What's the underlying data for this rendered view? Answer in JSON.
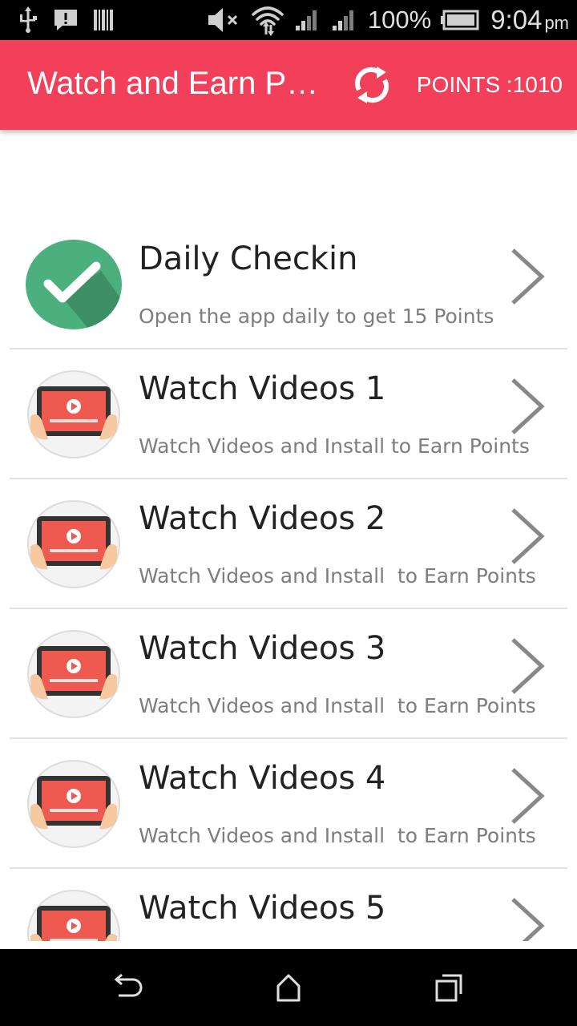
{
  "status_bar": {
    "battery": "100%",
    "time": "9:04",
    "ampm": "pm"
  },
  "app_bar": {
    "title": "Watch and Earn Pa...",
    "points_label": "POINTS :1010",
    "accent": "#f2405a"
  },
  "list": {
    "items": [
      {
        "title": "Daily Checkin",
        "subtitle": "Open the app daily to get 15 Points",
        "icon": "checkmark-circle-icon"
      },
      {
        "title": "Watch Videos 1",
        "subtitle": "Watch Videos and Install to Earn Points",
        "icon": "video-tablet-icon"
      },
      {
        "title": "Watch Videos 2",
        "subtitle": "Watch Videos and Install  to Earn Points",
        "icon": "video-tablet-icon"
      },
      {
        "title": "Watch Videos 3",
        "subtitle": "Watch Videos and Install  to Earn Points",
        "icon": "video-tablet-icon"
      },
      {
        "title": "Watch Videos 4",
        "subtitle": "Watch Videos and Install  to Earn Points",
        "icon": "video-tablet-icon"
      },
      {
        "title": "Watch Videos 5",
        "subtitle": "",
        "icon": "video-tablet-icon"
      }
    ]
  },
  "nav_bar": {
    "buttons": [
      "back-icon",
      "home-icon",
      "recents-icon"
    ]
  }
}
